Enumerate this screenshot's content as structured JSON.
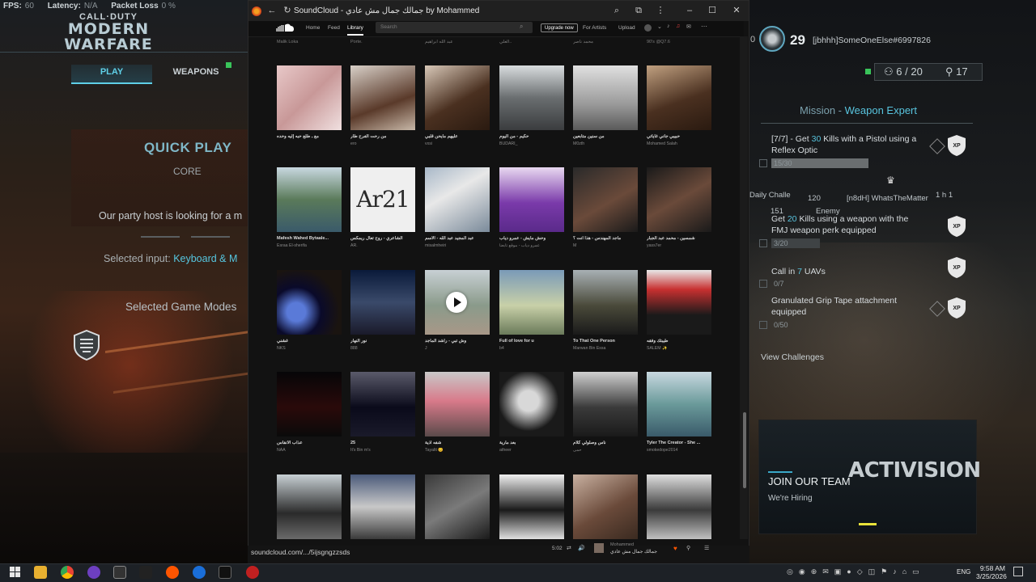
{
  "game": {
    "hud": {
      "fps_label": "FPS:",
      "fps_value": "60",
      "latency_label": "Latency:",
      "latency_value": "N/A",
      "packet_label": "Packet Loss",
      "packet_value": "0 %"
    },
    "logo": {
      "line1": "CALL·DUTY",
      "line2": "MODERN",
      "line3": "WARFARE"
    },
    "tabs": {
      "play": "PLAY",
      "weapons": "WEAPONS"
    },
    "quick_play": {
      "title": "QUICK PLAY",
      "subtitle": "CORE",
      "host_msg": "Our party host is looking for a m",
      "input_label": "Selected input:",
      "input_value": "Keyboard & M",
      "modes_label": "Selected Game Modes"
    },
    "player": {
      "prefix": "0",
      "level": "29",
      "name": "[jbhhh]SomeOneElse#6997826"
    },
    "party": {
      "count": "6 / 20",
      "count2": "17"
    },
    "mission": {
      "prefix": "Mission - ",
      "name": "Weapon Expert"
    },
    "challenges": [
      {
        "line1_pre": "[7/7] - Get ",
        "line1_num": "30",
        "line1_post": " Kills with a Pistol using a",
        "line2": "Reflex Optic",
        "progress": "15/30"
      },
      {
        "line1_pre": "Get ",
        "line1_num": "20",
        "line1_post": " Kills using a weapon with the",
        "line2": "FMJ weapon perk equipped",
        "progress": "3/20"
      },
      {
        "line1_pre": "Call in ",
        "line1_num": "7",
        "line1_post": " UAVs",
        "line2": "",
        "progress": "0/7"
      },
      {
        "line1_pre": "Granulated Grip Tape attachment",
        "line1_num": "",
        "line1_post": "",
        "line2": "equipped",
        "progress": "0/50"
      }
    ],
    "overlay": {
      "daily": "Daily Challe",
      "enemy": "Enemy",
      "n8dh": "[n8dH] WhatsTheMatter",
      "ping": "151",
      "time": "1 h 1",
      "count": "120"
    },
    "view_challenges": "View Challenges",
    "activision": {
      "logo": "ACTIVISION",
      "join": "JOIN OUR TEAM",
      "hiring": "We're Hiring"
    }
  },
  "browser": {
    "title": "SoundCloud - جمالك جمال مش عادي by Mohammed",
    "nav": {
      "home": "Home",
      "feed": "Feed",
      "library": "Library",
      "search_placeholder": "Search",
      "upgrade": "Upgrade now",
      "for_artists": "For Artists",
      "upload": "Upload"
    },
    "top_users": [
      "Malik Loka",
      "Porte.",
      "عبد الله ابراهيم",
      "العلي..",
      "محمد ناصر",
      "90's @Q7.6"
    ],
    "rows": [
      [
        {
          "title": "مع ـ طلع حبه إليه وحده",
          "user": ""
        },
        {
          "title": "من رحت الفرح طار",
          "user": "ero"
        },
        {
          "title": "عليهم مايحن قلبي ",
          "user": "vxsi"
        },
        {
          "title": "حكيم - من اليوم",
          "user": "BUDARI_"
        },
        {
          "title": "من سنين متابعين",
          "user": "M0zth"
        },
        {
          "title": "حبيبي جاني غاياتي",
          "user": "Mohamed Salah"
        }
      ],
      [
        {
          "title": "Mafesh Wahed Bytaale...",
          "user": "Esraa El-sherifa"
        },
        {
          "title": "الشاعري - روح تعال ريمكس",
          "user": "AR."
        },
        {
          "title": "عبد المجيد عبد الله - الاسم",
          "user": "misalmheiri"
        },
        {
          "title": "وحش مايش - عمرو دياب",
          "user": "عمرو دياب - موقع تابعنا"
        },
        {
          "title": "ماجد المهندس - هذا انت ؟",
          "user": "M"
        },
        {
          "title": "شمسين - محمد عبد الجبار",
          "user": "yass7er"
        }
      ],
      [
        {
          "title": "غشني",
          "user": "NKS"
        },
        {
          "title": "نور النهار",
          "user": "888"
        },
        {
          "title": "وش تبي - راشد الماجد",
          "user": "J"
        },
        {
          "title": "Full of love for u",
          "user": "b4"
        },
        {
          "title": "To That One Person",
          "user": "Marwan Bin Essa"
        },
        {
          "title": "طيبتك وفقه",
          "user": "SALEM ✨"
        }
      ],
      [
        {
          "title": "عذاب الأنفاس",
          "user": "NAA"
        },
        {
          "title": "25",
          "user": "It's Bin m's"
        },
        {
          "title": "شفه اذية",
          "user": "Tayaltt 😊"
        },
        {
          "title": "بعد مارية",
          "user": "atheer"
        },
        {
          "title": "ناس وصلولي كلام",
          "user": "حمى"
        },
        {
          "title": "Tyler The Creator - She ...",
          "user": "smokedope2014"
        }
      ]
    ],
    "ar21_text": "Ar21",
    "status_url": "soundcloud.com/.../5ijsgngzzsds",
    "player": {
      "time": "5:02",
      "artist": "Mohammed",
      "track": "جمالك جمال مش عادي"
    }
  },
  "taskbar": {
    "lang": "ENG",
    "time": "9:58 AM",
    "date": "3/25/2026"
  },
  "colors": {
    "accent_cyan": "#5fd0e8",
    "sc_orange": "#ff5500",
    "green": "#39c45a"
  }
}
